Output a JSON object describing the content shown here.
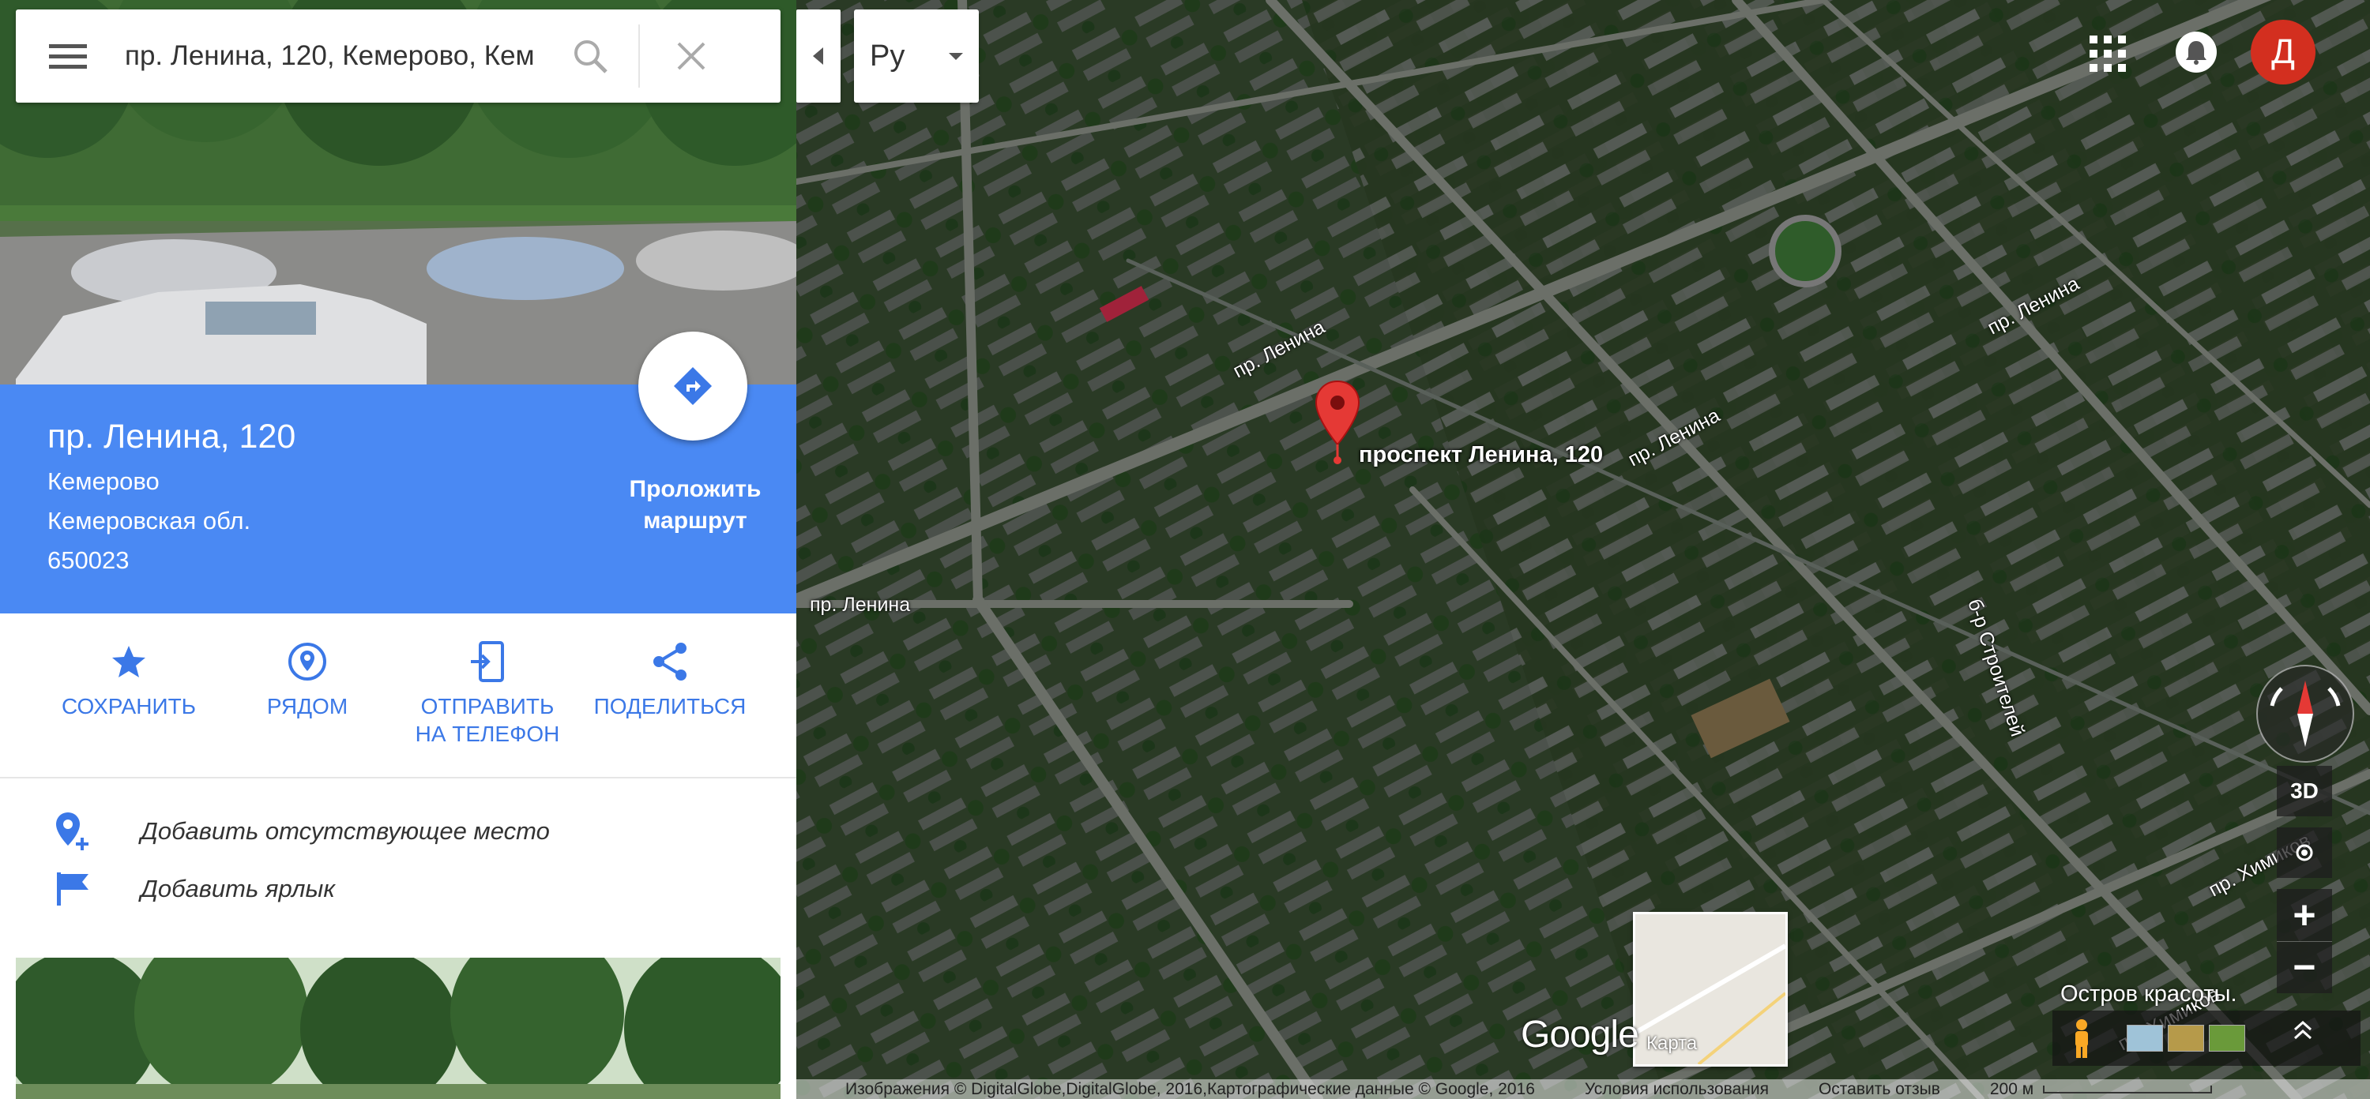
{
  "search": {
    "value": "пр. Ленина, 120, Кемерово, Кем"
  },
  "place": {
    "title": "пр. Ленина, 120",
    "city": "Кемерово",
    "region": "Кемеровская обл.",
    "postal": "650023",
    "route_label_1": "Проложить",
    "route_label_2": "маршрут"
  },
  "actions": [
    {
      "label": "СОХРАНИТЬ",
      "icon": "star-icon"
    },
    {
      "label": "РЯДОМ",
      "icon": "nearby-icon"
    },
    {
      "label_1": "ОТПРАВИТЬ",
      "label_2": "НА ТЕЛЕФОН",
      "icon": "send-to-phone-icon"
    },
    {
      "label": "ПОДЕЛИТЬСЯ",
      "icon": "share-icon"
    }
  ],
  "extras": [
    {
      "label": "Добавить отсутствующее место",
      "icon": "add-place-icon"
    },
    {
      "label": "Добавить ярлык",
      "icon": "flag-icon"
    }
  ],
  "map": {
    "language": "Ру",
    "pin_label": "проспект Ленина, 120",
    "road_labels": [
      "пр. Ленина",
      "пр. Ленина",
      "пр. Ленина",
      "пр. Ленина",
      "б-р Строителей",
      "пр. Химиков",
      "пр. Химиков"
    ],
    "minimap_label": "Карта",
    "brand": "Google",
    "poi": "Остров красоты.",
    "avatar_letter": "Д",
    "btn_3d": "3D",
    "zoom_in": "+",
    "zoom_out": "−",
    "footer": {
      "attribution": "Изображения © DigitalGlobe,DigitalGlobe, 2016,Картографические данные © Google, 2016",
      "terms": "Условия использования",
      "feedback": "Оставить отзыв",
      "scale": "200 м"
    }
  },
  "colors": {
    "accent": "#4a89f3",
    "action": "#3b78e7",
    "pin": "#e53935",
    "avatar": "#d32f1f"
  }
}
